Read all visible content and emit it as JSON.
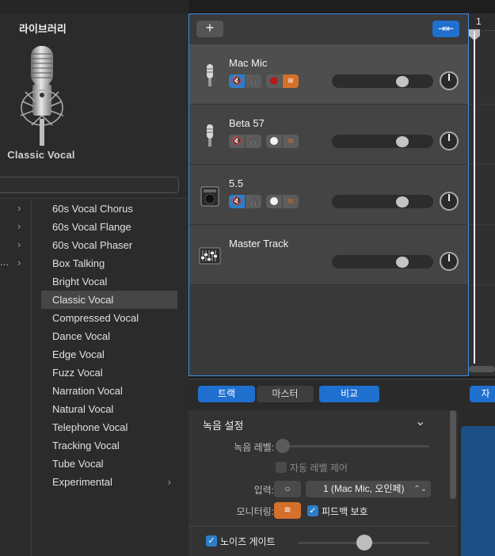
{
  "library": {
    "title": "라이브러리",
    "patch_name": "Classic Vocal",
    "category_rows": [
      {
        "has_dots": false
      },
      {
        "has_dots": false
      },
      {
        "has_dots": false
      },
      {
        "has_dots": true,
        "dots": "..."
      }
    ],
    "presets": [
      {
        "label": "60s Vocal Chorus"
      },
      {
        "label": "60s Vocal Flange"
      },
      {
        "label": "60s Vocal Phaser"
      },
      {
        "label": "Box Talking"
      },
      {
        "label": "Bright Vocal"
      },
      {
        "label": "Classic Vocal",
        "selected": true
      },
      {
        "label": "Compressed Vocal"
      },
      {
        "label": "Dance Vocal"
      },
      {
        "label": "Edge Vocal"
      },
      {
        "label": "Fuzz Vocal"
      },
      {
        "label": "Narration Vocal"
      },
      {
        "label": "Natural Vocal"
      },
      {
        "label": "Telephone Vocal"
      },
      {
        "label": "Tracking Vocal"
      },
      {
        "label": "Tube Vocal"
      },
      {
        "label": "Experimental",
        "has_children": true
      }
    ]
  },
  "tracks_header": {
    "add_label": "+",
    "smart_label": "⇥⇤"
  },
  "tracks": [
    {
      "name": "Mac Mic",
      "icon": "microphone-icon",
      "selected": true,
      "muted": true,
      "record_armed": true,
      "monitoring": true,
      "volume": 0.72
    },
    {
      "name": "Beta 57",
      "icon": "microphone-icon",
      "selected": false,
      "muted": false,
      "record_armed": false,
      "monitoring": false,
      "volume": 0.72
    },
    {
      "name": "5.5",
      "icon": "amp-icon",
      "selected": false,
      "muted": true,
      "record_armed": false,
      "monitoring": false,
      "volume": 0.72
    },
    {
      "name": "Master Track",
      "icon": "master-icon",
      "selected": false,
      "master": true,
      "volume": 0.72
    }
  ],
  "timeline": {
    "bar_number": "1"
  },
  "control_bar": {
    "tab_track": "트랙",
    "tab_master": "마스터",
    "compare": "비교",
    "right_tab": "자"
  },
  "recording_settings": {
    "title": "녹음 설정",
    "rec_level_label": "녹음 레벨:",
    "auto_level_label": "자동 레벨 제어",
    "input_label": "입력:",
    "input_mono": "○",
    "input_value": "1  (Mac Mic, 오인페)",
    "monitoring_label": "모니터링:",
    "feedback_label": "피드백 보호",
    "noise_gate_label": "노이즈 게이트"
  },
  "colors": {
    "accent_blue": "#1f6fcf",
    "monitor_orange": "#d4702a",
    "record_red": "#b3191b"
  }
}
